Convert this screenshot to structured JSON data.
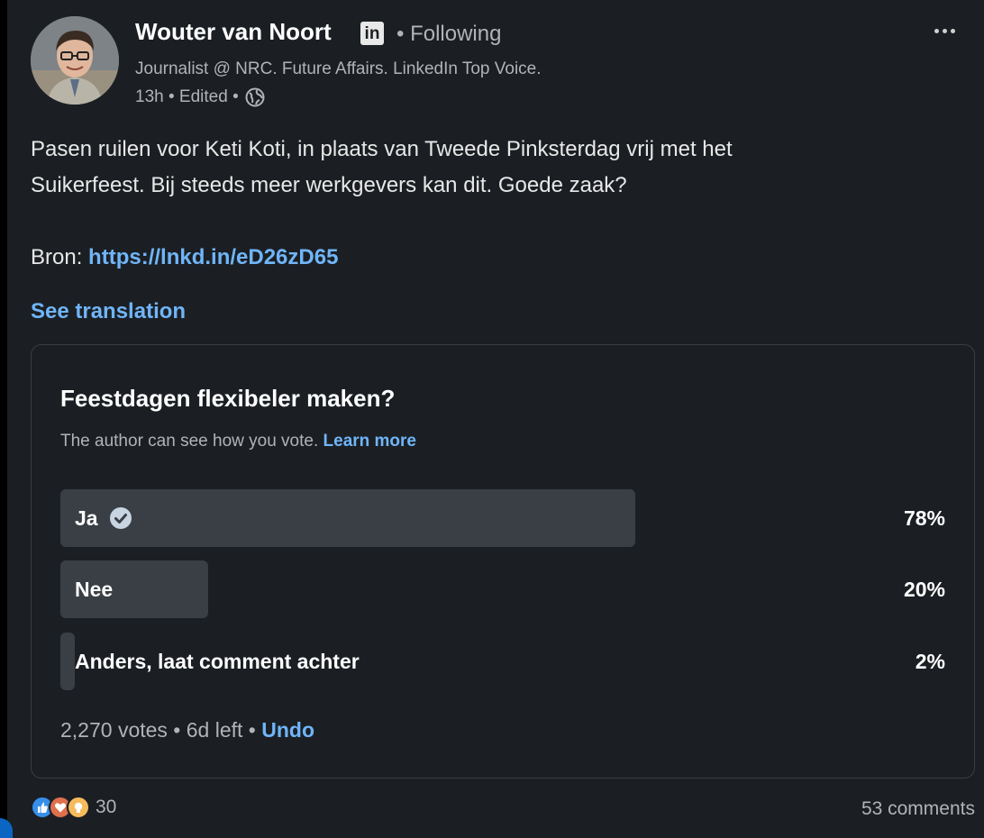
{
  "author": {
    "name": "Wouter van Noort",
    "badge": "in",
    "following": "• Following",
    "headline": "Journalist @ NRC. Future Affairs. LinkedIn Top Voice.",
    "meta": "13h • Edited •"
  },
  "post": {
    "text_line1": "Pasen ruilen voor Keti Koti, in plaats van Tweede Pinksterdag vrij met het",
    "text_line2": "Suikerfeest. Bij steeds meer werkgevers kan dit. Goede zaak?",
    "source_label": "Bron:",
    "source_link": "https://lnkd.in/eD26zD65",
    "see_translation": "See translation"
  },
  "poll": {
    "question": "Feestdagen flexibeler maken?",
    "note": "The author can see how you vote.",
    "learn_more": "Learn more",
    "options": [
      {
        "label": "Ja",
        "percent_label": "78%",
        "percent": 78,
        "selected": true
      },
      {
        "label": "Nee",
        "percent_label": "20%",
        "percent": 20,
        "selected": false
      },
      {
        "label": "Anders, laat comment achter",
        "percent_label": "2%",
        "percent": 2,
        "selected": false
      }
    ],
    "footer": "2,270 votes • 6d left •",
    "undo": "Undo"
  },
  "social": {
    "reaction_icons": [
      "like-icon",
      "love-icon",
      "insightful-icon"
    ],
    "reaction_count": "30",
    "comments": "53 comments"
  },
  "colors": {
    "background": "#1b1f23",
    "link": "#70b5f9",
    "bar": "#3a3f45",
    "muted_text": "#b0b3b7"
  }
}
